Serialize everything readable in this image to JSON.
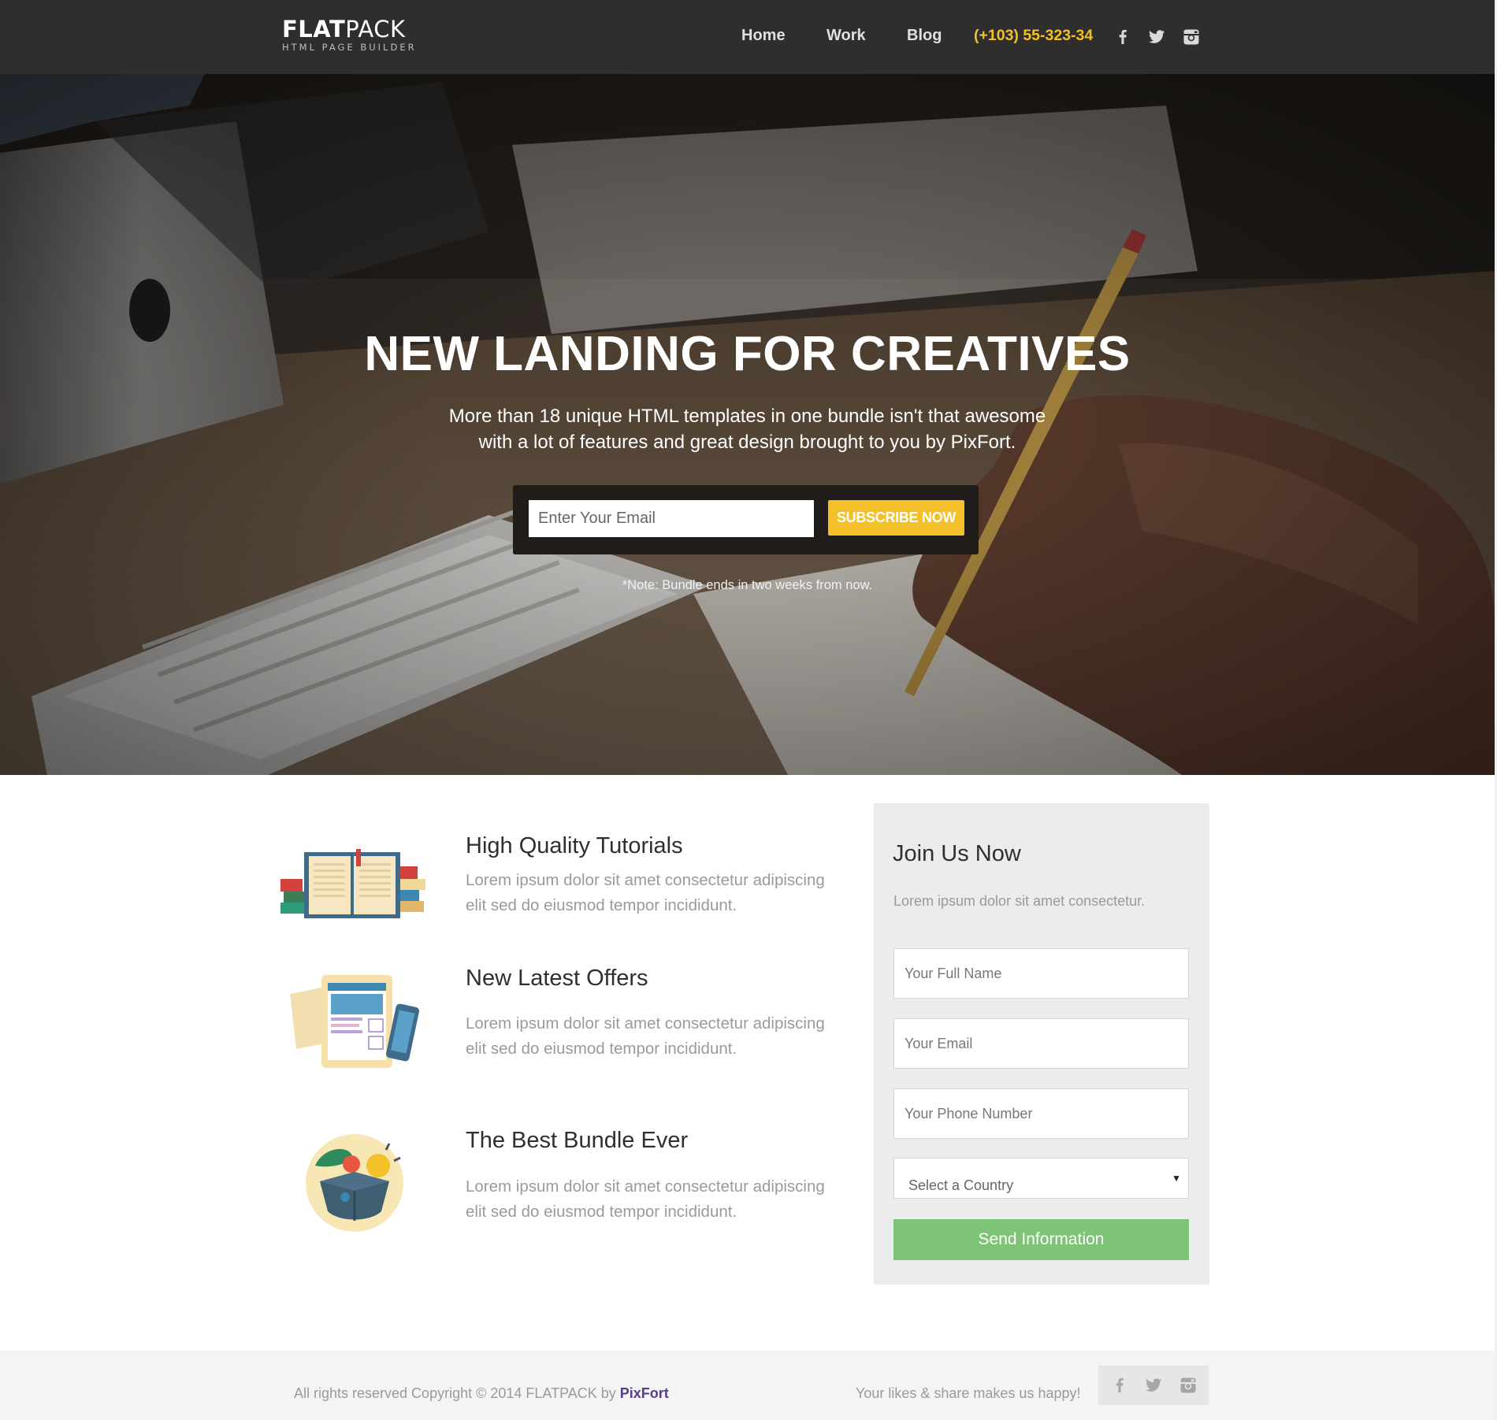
{
  "brand": {
    "logo_bold": "FLAT",
    "logo_light": "PACK",
    "logo_sub": "HTML PAGE BUILDER"
  },
  "nav": {
    "items": [
      {
        "label": "Home"
      },
      {
        "label": "Work"
      },
      {
        "label": "Blog"
      }
    ],
    "phone": "(+103) 55-323-34",
    "social_icons": [
      "facebook-icon",
      "twitter-icon",
      "instagram-icon"
    ]
  },
  "hero": {
    "title": "NEW LANDING FOR CREATIVES",
    "subtitle_line1": "More than 18 unique HTML templates in one bundle isn't that awesome",
    "subtitle_line2": "with a lot of features and great design brought to you by PixFort.",
    "email_placeholder": "Enter Your Email",
    "subscribe_label": "SUBSCRIBE NOW",
    "note": "*Note: Bundle ends in two weeks from now."
  },
  "features": [
    {
      "icon": "books-icon",
      "title": "High Quality Tutorials",
      "desc_line1": "Lorem ipsum dolor sit amet consectetur adipiscing",
      "desc_line2": "elit sed do eiusmod tempor incididunt."
    },
    {
      "icon": "tablet-phone-icon",
      "title": "New Latest Offers",
      "desc_line1": "Lorem ipsum dolor sit amet consectetur adipiscing",
      "desc_line2": "elit sed do eiusmod tempor incididunt."
    },
    {
      "icon": "gift-box-icon",
      "title": "The Best Bundle Ever",
      "desc_line1": "Lorem ipsum dolor sit amet consectetur adipiscing",
      "desc_line2": "elit sed do eiusmod tempor incididunt."
    }
  ],
  "join": {
    "title": "Join Us Now",
    "desc": "Lorem ipsum dolor sit amet consectetur.",
    "name_placeholder": "Your Full Name",
    "email_placeholder": "Your Email",
    "phone_placeholder": "Your Phone Number",
    "country_selected": "Select a Country",
    "send_label": "Send Information"
  },
  "footer": {
    "copyright_prefix": "All rights reserved Copyright © 2014 FLATPACK by ",
    "copyright_brand": "PixFort",
    "happy": "Your likes & share makes us happy!"
  },
  "colors": {
    "accent_yellow": "#f4c02a",
    "send_green": "#7ec476",
    "topbar": "#2e2e2e",
    "brand_purple": "#5a3d8a"
  }
}
